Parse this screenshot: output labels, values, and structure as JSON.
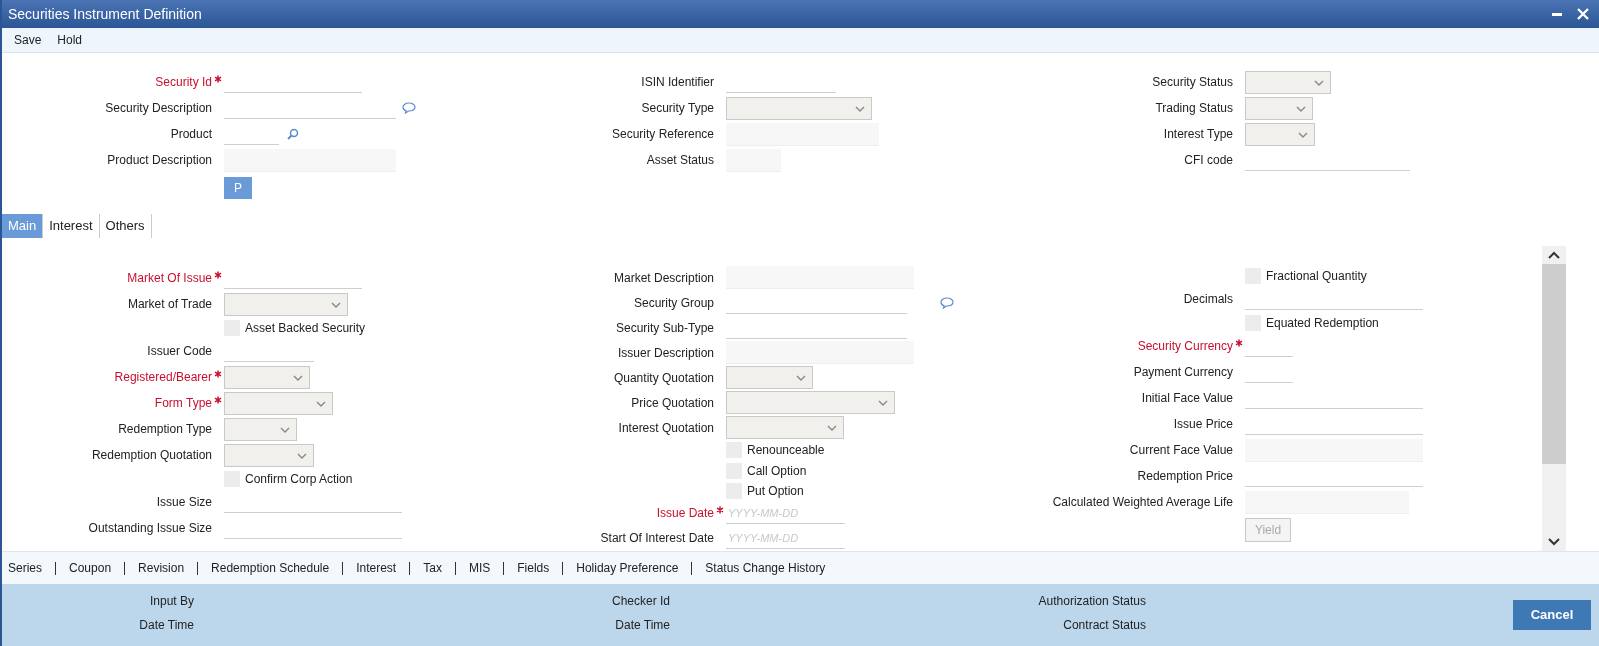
{
  "window": {
    "title": "Securities Instrument Definition"
  },
  "toolbar": [
    "Save",
    "Hold"
  ],
  "header": {
    "columns": [
      [
        {
          "kind": "text",
          "label": "Security Id",
          "required": true
        },
        {
          "kind": "text",
          "label": "Security Description",
          "required": false
        },
        {
          "kind": "text",
          "label": "Product",
          "required": false
        },
        {
          "kind": "readonly",
          "label": "Product Description",
          "required": false
        },
        {
          "kind": "button",
          "label": "P",
          "disabled": false
        }
      ],
      [
        {
          "kind": "text",
          "label": "ISIN Identifier",
          "required": false
        },
        {
          "kind": "select",
          "label": "Security Type",
          "required": false
        },
        {
          "kind": "readonly",
          "label": "Security Reference",
          "required": false
        },
        {
          "kind": "readonly",
          "label": "Asset Status",
          "required": false
        }
      ],
      [
        {
          "kind": "select",
          "label": "Security Status",
          "required": false
        },
        {
          "kind": "select",
          "label": "Trading Status",
          "required": false
        },
        {
          "kind": "select",
          "label": "Interest Type",
          "required": false
        },
        {
          "kind": "text",
          "label": "CFI code",
          "required": false
        }
      ]
    ]
  },
  "tabs": [
    {
      "label": "Main",
      "selected": true
    },
    {
      "label": "Interest",
      "selected": false
    },
    {
      "label": "Others",
      "selected": false
    }
  ],
  "main": {
    "columns": [
      [
        {
          "kind": "text",
          "label": "Market Of Issue",
          "required": true
        },
        {
          "kind": "select",
          "label": "Market of Trade",
          "required": false
        },
        {
          "kind": "checkbox",
          "label": "Asset Backed Security",
          "checked": false
        },
        {
          "kind": "text",
          "label": "Issuer Code",
          "required": false
        },
        {
          "kind": "select",
          "label": "Registered/Bearer",
          "required": true
        },
        {
          "kind": "select",
          "label": "Form Type",
          "required": true
        },
        {
          "kind": "select",
          "label": "Redemption Type",
          "required": false
        },
        {
          "kind": "select",
          "label": "Redemption Quotation",
          "required": false
        },
        {
          "kind": "checkbox",
          "label": "Confirm Corp Action",
          "checked": false
        },
        {
          "kind": "text",
          "label": "Issue Size",
          "required": false
        },
        {
          "kind": "text",
          "label": "Outstanding Issue Size",
          "required": false
        }
      ],
      [
        {
          "kind": "readonly",
          "label": "Market Description",
          "required": false
        },
        {
          "kind": "text",
          "label": "Security Group",
          "required": false
        },
        {
          "kind": "text",
          "label": "Security Sub-Type",
          "required": false
        },
        {
          "kind": "readonly",
          "label": "Issuer Description",
          "required": false
        },
        {
          "kind": "select",
          "label": "Quantity Quotation",
          "required": false
        },
        {
          "kind": "select",
          "label": "Price Quotation",
          "required": false
        },
        {
          "kind": "select",
          "label": "Interest Quotation",
          "required": false
        },
        {
          "kind": "checkbox",
          "label": "Renounceable",
          "checked": false
        },
        {
          "kind": "checkbox",
          "label": "Call Option",
          "checked": false
        },
        {
          "kind": "checkbox",
          "label": "Put Option",
          "checked": false
        },
        {
          "kind": "date",
          "label": "Issue Date",
          "required": true,
          "placeholder": "YYYY-MM-DD"
        },
        {
          "kind": "date",
          "label": "Start Of Interest Date",
          "required": false,
          "placeholder": "YYYY-MM-DD"
        }
      ],
      [
        {
          "kind": "checkbox",
          "label": "Fractional Quantity",
          "checked": false
        },
        {
          "kind": "text",
          "label": "Decimals",
          "required": false
        },
        {
          "kind": "checkbox",
          "label": "Equated Redemption",
          "checked": false
        },
        {
          "kind": "text",
          "label": "Security Currency",
          "required": true
        },
        {
          "kind": "text",
          "label": "Payment Currency",
          "required": false
        },
        {
          "kind": "text",
          "label": "Initial Face Value",
          "required": false
        },
        {
          "kind": "text",
          "label": "Issue Price",
          "required": false
        },
        {
          "kind": "readonly",
          "label": "Current Face Value",
          "required": false
        },
        {
          "kind": "text",
          "label": "Redemption Price",
          "required": false
        },
        {
          "kind": "readonly",
          "label": "Calculated Weighted Average Life",
          "required": false
        },
        {
          "kind": "button",
          "label": "Yield",
          "disabled": true
        }
      ]
    ]
  },
  "subsystems": [
    "Series",
    "Coupon",
    "Revision",
    "Redemption Schedule",
    "Interest",
    "Tax",
    "MIS",
    "Fields",
    "Holiday Preference",
    "Status Change History"
  ],
  "audit": [
    [
      "Input By",
      "Date Time"
    ],
    [
      "Checker Id",
      "Date Time"
    ],
    [
      "Authorization Status",
      "Contract Status"
    ]
  ],
  "buttons": [
    "Cancel"
  ]
}
